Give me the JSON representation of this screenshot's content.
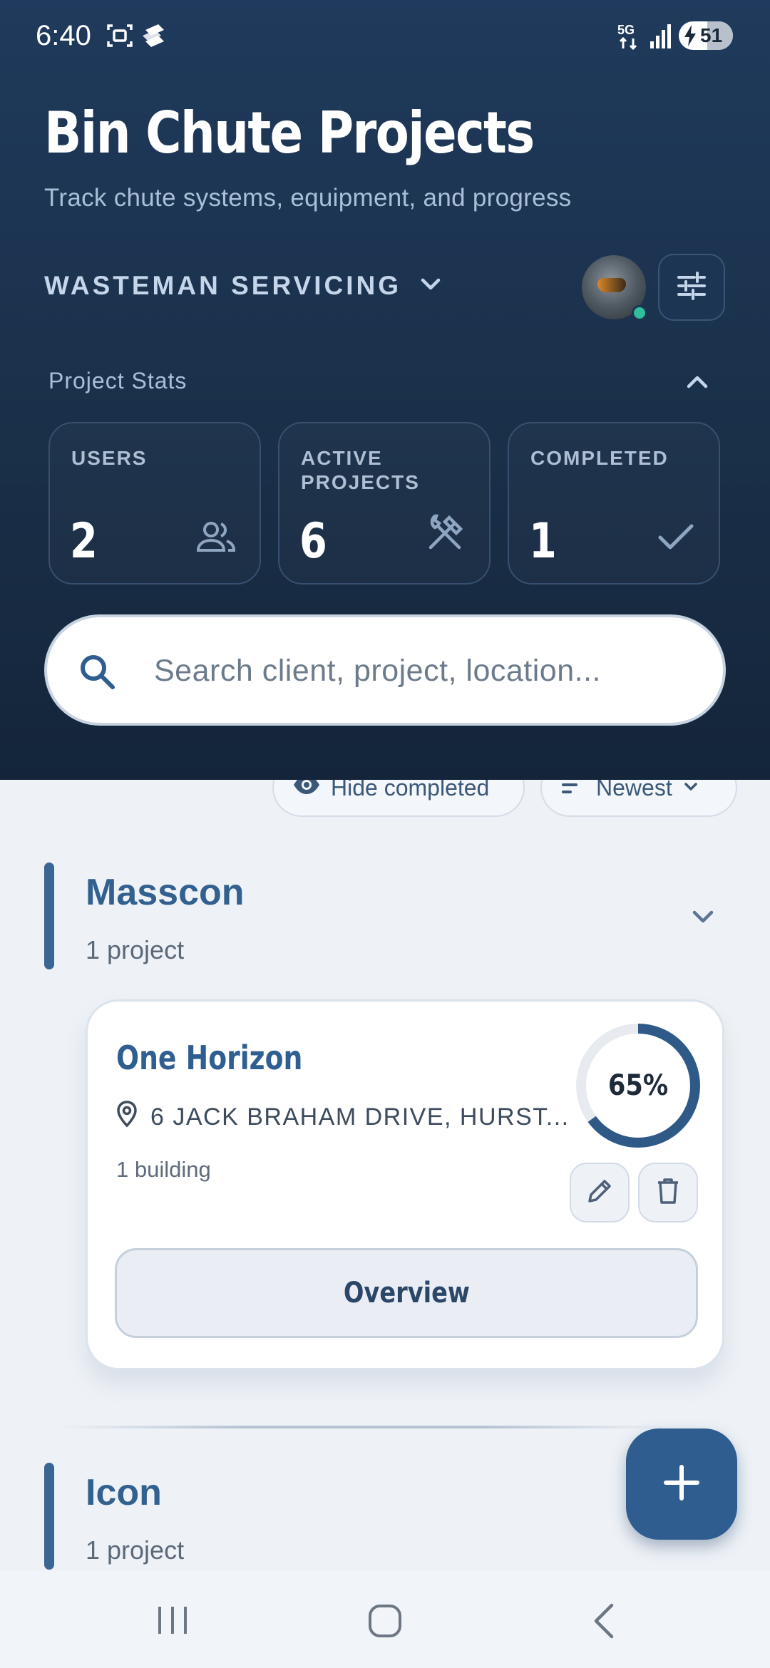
{
  "status_bar": {
    "time": "6:40",
    "network": "5G",
    "battery": "51"
  },
  "header": {
    "title": "Bin Chute Projects",
    "subtitle": "Track chute systems, equipment, and progress",
    "organization": "WASTEMAN SERVICING"
  },
  "stats": {
    "label": "Project Stats",
    "cards": [
      {
        "label": "USERS",
        "value": "2",
        "icon": "users-icon"
      },
      {
        "label": "ACTIVE PROJECTS",
        "value": "6",
        "icon": "hammer-wrench-icon"
      },
      {
        "label": "COMPLETED",
        "value": "1",
        "icon": "checkmark-icon"
      }
    ]
  },
  "search": {
    "placeholder": "Search client, project, location..."
  },
  "filters": {
    "hide_completed": "Hide completed",
    "sort": "Newest"
  },
  "groups": [
    {
      "name": "Masscon",
      "count": "1 project",
      "projects": [
        {
          "title": "One Horizon",
          "address": "6 JACK BRAHAM DRIVE, HURST...",
          "buildings": "1 building",
          "progress": 65,
          "progress_label": "65%",
          "action": "Overview"
        }
      ]
    },
    {
      "name": "Icon",
      "count": "1 project"
    }
  ],
  "colors": {
    "header_bg": "#1d3552",
    "accent": "#2f5d8f",
    "online": "#2fbf9a"
  }
}
